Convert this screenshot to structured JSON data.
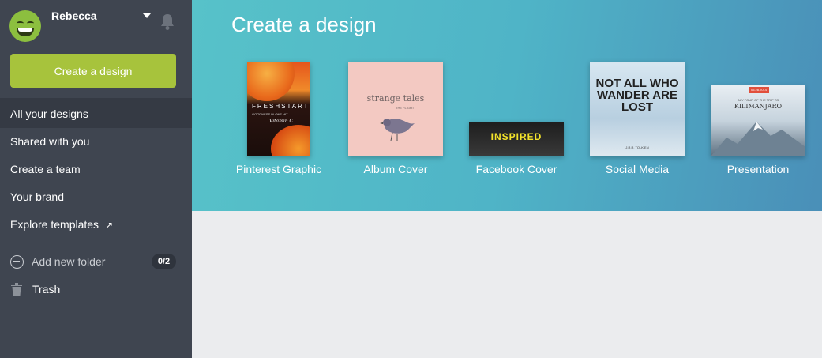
{
  "user": {
    "name": "Rebecca"
  },
  "sidebar": {
    "create_button": "Create a design",
    "nav": [
      {
        "label": "All your designs",
        "active": true
      },
      {
        "label": "Shared with you"
      },
      {
        "label": "Create a team"
      },
      {
        "label": "Your brand"
      },
      {
        "label": "Explore templates",
        "icon": "external-link-icon"
      }
    ],
    "add_folder_label": "Add new folder",
    "folder_count": "0/2",
    "trash_label": "Trash"
  },
  "hero": {
    "title": "Create a design",
    "templates": [
      {
        "label": "Pinterest Graphic",
        "thumb_text": [
          "FRESHSTART",
          "GOODNESS IN ONE HIT",
          "Vitamin C"
        ]
      },
      {
        "label": "Album Cover",
        "thumb_text": [
          "strange tales",
          "THE FLIGHT"
        ]
      },
      {
        "label": "Facebook Cover",
        "thumb_text": [
          "INSPIRED"
        ]
      },
      {
        "label": "Social Media",
        "thumb_text": [
          "NOT ALL WHO WANDER ARE LOST",
          "J.R.R. TOLKIEN"
        ]
      },
      {
        "label": "Presentation",
        "thumb_text": [
          "05.28.2014",
          "DAY FOUR OF THE TRIP TO",
          "KILIMANJARO"
        ]
      }
    ]
  },
  "colors": {
    "sidebar_bg": "#3f4550",
    "accent_green": "#a7c33c",
    "hero_teal": "#57c2c9"
  }
}
